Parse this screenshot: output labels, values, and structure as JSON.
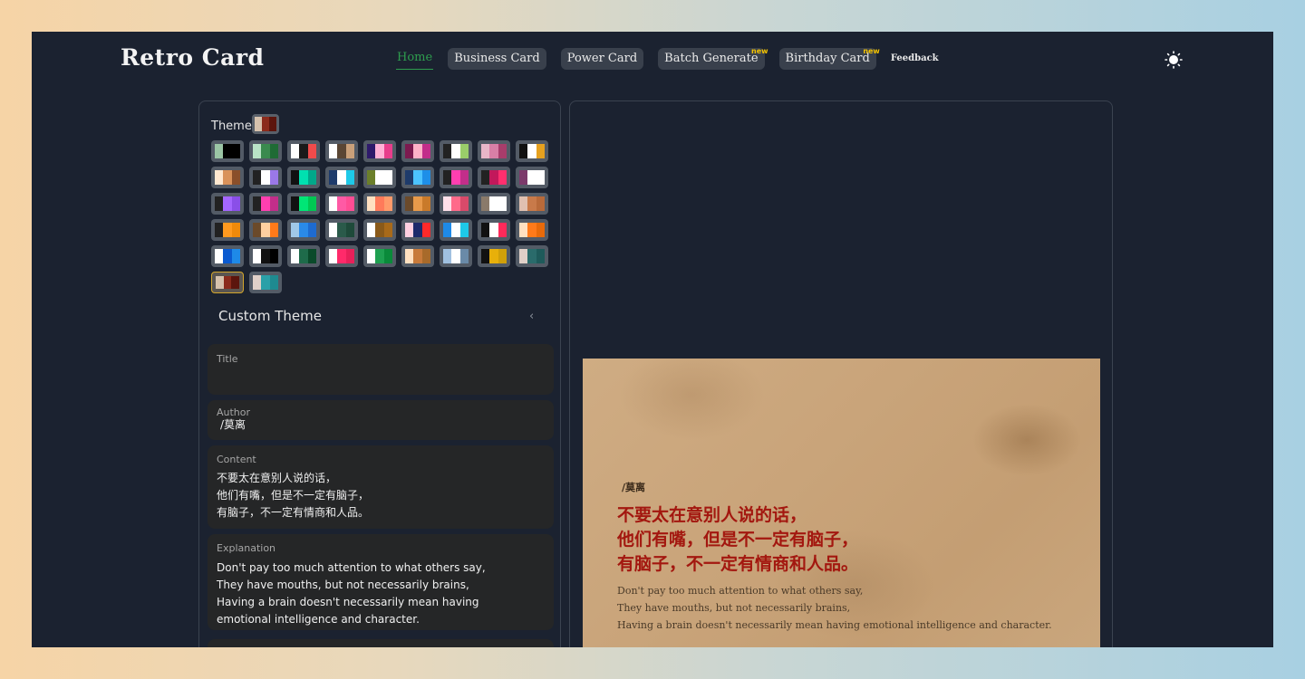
{
  "app": {
    "title": "Retro Card"
  },
  "nav": {
    "items": [
      {
        "label": "Home"
      },
      {
        "label": "Business Card"
      },
      {
        "label": "Power Card"
      },
      {
        "label": "Batch Generate",
        "badge": "new"
      },
      {
        "label": "Birthday Card",
        "badge": "new"
      },
      {
        "label": "Feedback"
      }
    ],
    "theme_toggle_icon": "sun-icon"
  },
  "theme": {
    "label": "Theme",
    "current": [
      "#d7c2ad",
      "#8b2b1c",
      "#5c150d"
    ],
    "swatches": [
      [
        "#9bc5a5",
        "#000000",
        "#000000"
      ],
      [
        "#b9e3c6",
        "#3a8a4e",
        "#1f6b35"
      ],
      [
        "#ffffff",
        "#1a1a1a",
        "#ef4b4b"
      ],
      [
        "#ffffff",
        "#5a4634",
        "#c9a07a"
      ],
      [
        "#2e1a6b",
        "#ffb1d6",
        "#e83e8c"
      ],
      [
        "#7c1a4f",
        "#ffb1c8",
        "#c22e8a"
      ],
      [
        "#222222",
        "#ffffff",
        "#9acd6a"
      ],
      [
        "#e8b6c8",
        "#d97fa6",
        "#a83d6b"
      ],
      [
        "#111111",
        "#ffffff",
        "#e6a11f"
      ],
      [
        "#ffe8d0",
        "#d9925a",
        "#8a4f2a"
      ],
      [
        "#222222",
        "#ffffff",
        "#9a78e8"
      ],
      [
        "#111111",
        "#00e0b0",
        "#00a88a"
      ],
      [
        "#1e3b6b",
        "#ffffff",
        "#1ec9e8"
      ],
      [
        "#6b7f2a",
        "#ffffff",
        "#ffffff"
      ],
      [
        "#1e3b6b",
        "#4cc3ff",
        "#1e8fe8"
      ],
      [
        "#222222",
        "#ff3fb0",
        "#c22e8a"
      ],
      [
        "#222222",
        "#c2185b",
        "#ff2f6e"
      ],
      [
        "#7c3a6b",
        "#ffffff",
        "#ffffff"
      ],
      [
        "#222222",
        "#a466ff",
        "#8a4fe8"
      ],
      [
        "#222222",
        "#ff3fb0",
        "#c22e8a"
      ],
      [
        "#111111",
        "#00e676",
        "#00c853"
      ],
      [
        "#ffffff",
        "#ff5aa5",
        "#ff4d94"
      ],
      [
        "#ffe0c0",
        "#ff7a5a",
        "#ff9a6a"
      ],
      [
        "#6b4a2a",
        "#e89a4a",
        "#c97a2a"
      ],
      [
        "#ffe0ea",
        "#ff6a8a",
        "#d94a6a"
      ],
      [
        "#8a7a6a",
        "#ffffff",
        "#ffffff"
      ],
      [
        "#e0c0b0",
        "#c87a4a",
        "#b86a3a"
      ],
      [
        "#222222",
        "#ff9a1f",
        "#f08a0a"
      ],
      [
        "#6b4a2a",
        "#ffd0a0",
        "#ff7a1a"
      ],
      [
        "#a0c8e8",
        "#2a8ae8",
        "#1e6bd0"
      ],
      [
        "#ffffff",
        "#2a5a4a",
        "#1e4a3a"
      ],
      [
        "#ffffff",
        "#8a5a1a",
        "#a86a1a"
      ],
      [
        "#ffd0e0",
        "#1e2a6b",
        "#ff2a2a"
      ],
      [
        "#1e8ae8",
        "#ffffff",
        "#1ec9e8"
      ],
      [
        "#111111",
        "#ffffff",
        "#ff2a5a"
      ],
      [
        "#ffe0c0",
        "#ff7a1a",
        "#e86a0a"
      ],
      [
        "#ffffff",
        "#0a5ad0",
        "#1e8ae8"
      ],
      [
        "#ffffff",
        "#111111",
        "#000000"
      ],
      [
        "#ffffff",
        "#1e6b4a",
        "#0a4a2a"
      ],
      [
        "#ffffff",
        "#ff2a6a",
        "#e8205a"
      ],
      [
        "#ffffff",
        "#1ea050",
        "#0a8a3a"
      ],
      [
        "#ffe0c0",
        "#c87a3a",
        "#a86a2a"
      ],
      [
        "#a0c0e0",
        "#ffffff",
        "#6a8aa8"
      ],
      [
        "#111111",
        "#e8b00a",
        "#d0a00a"
      ],
      [
        "#e0d0c8",
        "#2a6b6b",
        "#1e5a5a"
      ],
      [
        "#d7c2ad",
        "#8b2b1c",
        "#5c150d"
      ],
      [
        "#e0d0c8",
        "#2aa0a8",
        "#1e8a90"
      ]
    ],
    "selected_index": 45
  },
  "custom_theme": {
    "label": "Custom Theme"
  },
  "form": {
    "title_label": "Title",
    "title_value": "",
    "author_label": "Author",
    "author_value": "/莫离",
    "content_label": "Content",
    "content_value": "不要太在意别人说的话，\n他们有嘴，但是不一定有脑子，\n有脑子，不一定有情商和人品。",
    "explanation_label": "Explanation",
    "explanation_value": "Don't pay too much attention to what others say,\nThey have mouths, but not necessarily brains,\nHaving a brain doesn't necessarily mean having\nemotional intelligence and character."
  },
  "card": {
    "author": "/莫离",
    "content": "不要太在意别人说的话，\n他们有嘴，但是不一定有脑子，\n有脑子，不一定有情商和人品。",
    "explanation": "Don't pay too much attention to what others say,\nThey have mouths, but not necessarily brains,\nHaving a brain doesn't necessarily mean having emotional intelligence and character."
  }
}
